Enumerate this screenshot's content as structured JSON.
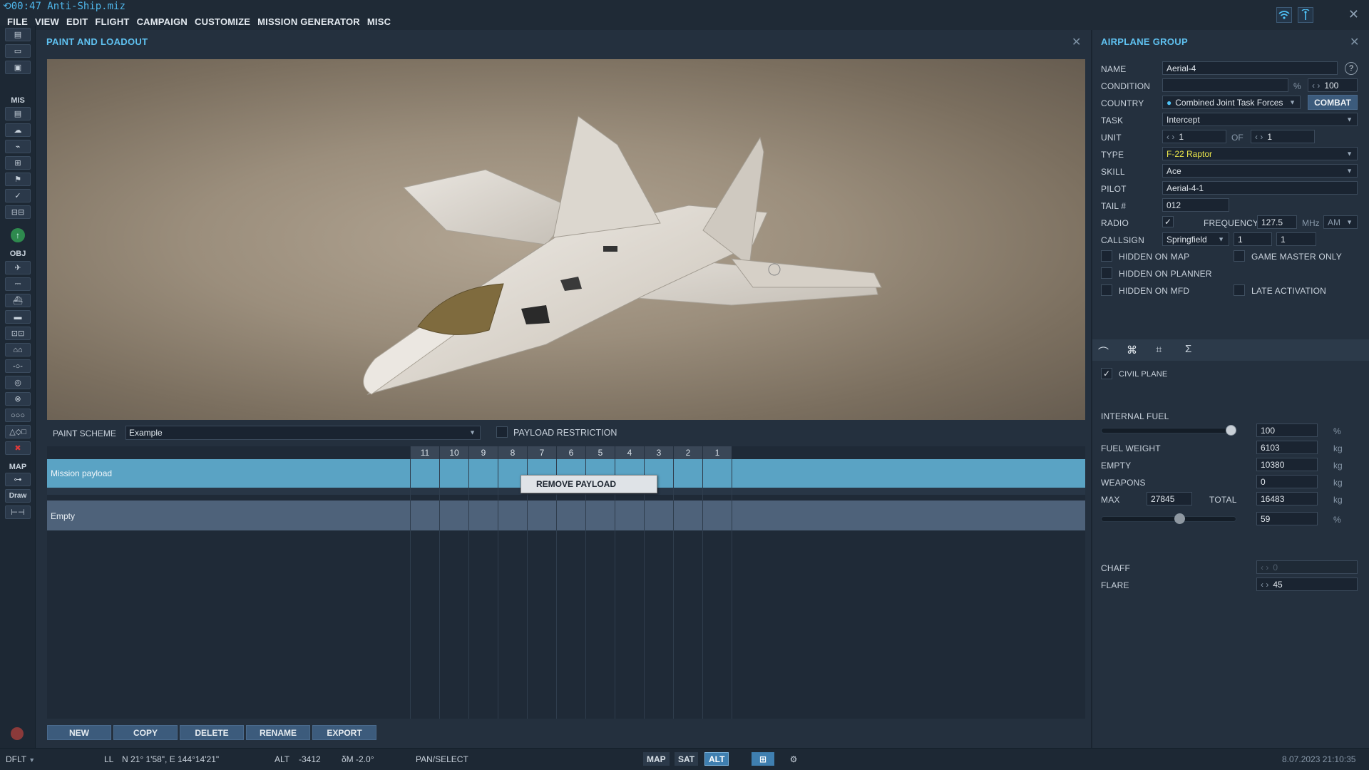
{
  "window": {
    "title": "00:47  Anti-Ship.miz"
  },
  "menu": [
    "FILE",
    "VIEW",
    "EDIT",
    "FLIGHT",
    "CAMPAIGN",
    "CUSTOMIZE",
    "MISSION GENERATOR",
    "MISC"
  ],
  "toolbar": {
    "mis_label": "MIS",
    "obj_label": "OBJ",
    "map_label": "MAP",
    "draw_label": "Draw"
  },
  "paint_panel": {
    "title": "PAINT AND LOADOUT",
    "paint_scheme_label": "PAINT SCHEME",
    "paint_scheme_value": "Example",
    "payload_restriction_label": "PAYLOAD RESTRICTION",
    "stations": [
      "11",
      "10",
      "9",
      "8",
      "7",
      "6",
      "5",
      "4",
      "3",
      "2",
      "1"
    ],
    "rows": [
      {
        "name": "Mission payload",
        "selected": true
      },
      {
        "name": "Empty",
        "selected": false
      }
    ],
    "context_menu": {
      "item": "REMOVE PAYLOAD"
    },
    "buttons": {
      "new": "NEW",
      "copy": "COPY",
      "delete": "DELETE",
      "rename": "RENAME",
      "export": "EXPORT"
    }
  },
  "airplane_group": {
    "title": "AIRPLANE GROUP",
    "help": "?",
    "name_label": "NAME",
    "name_value": "Aerial-4",
    "condition_label": "CONDITION",
    "condition_unit": "%",
    "condition_value": "100",
    "country_label": "COUNTRY",
    "country_value": "Combined Joint Task Forces",
    "combat_button": "COMBAT",
    "task_label": "TASK",
    "task_value": "Intercept",
    "unit_label": "UNIT",
    "unit_value": "1",
    "of_label": "OF",
    "of_value": "1",
    "type_label": "TYPE",
    "type_value": "F-22 Raptor",
    "skill_label": "SKILL",
    "skill_value": "Ace",
    "pilot_label": "PILOT",
    "pilot_value": "Aerial-4-1",
    "tail_label": "TAIL #",
    "tail_value": "012",
    "radio_label": "RADIO",
    "radio_checked": true,
    "frequency_label": "FREQUENCY",
    "frequency_value": "127.5",
    "frequency_unit": "MHz",
    "modulation": "AM",
    "callsign_label": "CALLSIGN",
    "callsign_value": "Springfield",
    "callsign_n1": "1",
    "callsign_n2": "1",
    "checks": {
      "hidden_on_map": "HIDDEN ON MAP",
      "game_master_only": "GAME MASTER ONLY",
      "hidden_on_planner": "HIDDEN ON PLANNER",
      "hidden_on_mfd": "HIDDEN ON MFD",
      "late_activation": "LATE ACTIVATION"
    },
    "tab_icons": [
      "route-icon",
      "loadout-icon",
      "command-icon",
      "summary-icon"
    ],
    "civil_plane_label": "CIVIL PLANE",
    "civil_plane_checked": true,
    "internal_fuel_label": "INTERNAL FUEL",
    "internal_fuel_level": 1.0,
    "internal_fuel_value": "100",
    "internal_fuel_unit": "%",
    "fuel_weight_label": "FUEL WEIGHT",
    "fuel_weight_value": "6103",
    "kg": "kg",
    "empty_label": "EMPTY",
    "empty_value": "10380",
    "weapons_label": "WEAPONS",
    "weapons_value": "0",
    "max_label": "MAX",
    "max_value": "27845",
    "total_label": "TOTAL",
    "total_value": "16483",
    "load_level": 0.59,
    "load_value": "59",
    "load_unit": "%",
    "chaff_label": "CHAFF",
    "chaff_value": "0",
    "flare_label": "FLARE",
    "flare_value": "45"
  },
  "statusbar": {
    "profile": "DFLT",
    "coord_mode": "LL",
    "coords": "N 21° 1'58\", E 144°14'21\"",
    "alt_label": "ALT",
    "alt_value": "-3412",
    "mag_var": "δM  -2.0°",
    "mode": "PAN/SELECT",
    "map_btn": "MAP",
    "sat_btn": "SAT",
    "alt_btn": "ALT",
    "datetime": "8.07.2023 21:10:35"
  },
  "colors": {
    "accent": "#5fc1f0",
    "selected_row": "#5aa3c4",
    "type_text": "#e8e34a"
  }
}
